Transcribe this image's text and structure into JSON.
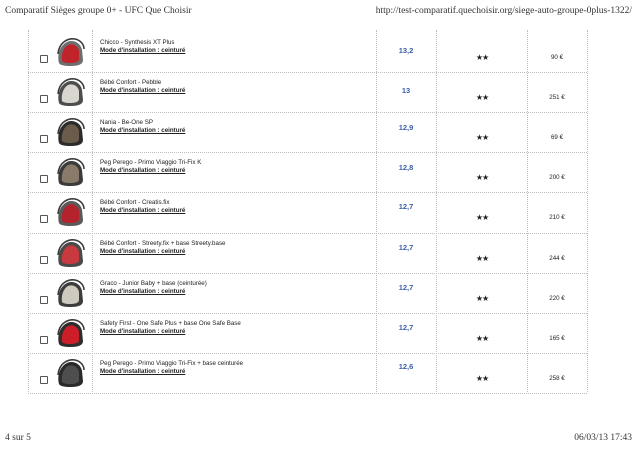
{
  "header": {
    "title": "Comparatif Sièges groupe 0+ - UFC Que Choisir",
    "url": "http://test-comparatif.quechoisir.org/siege-auto-groupe-0plus-1322/"
  },
  "footer": {
    "page": "4 sur 5",
    "datetime": "06/03/13 17:43"
  },
  "colors": {
    "score": "#3a5da8",
    "rule": "#bdbdbd"
  },
  "rows": [
    {
      "name": "Chicco  -  Synthesis XT Plus",
      "mode": "Mode d'installation : ceinturé",
      "score": "13,2",
      "stars": "★★",
      "price": "90 €",
      "seat_color": "#c0242a",
      "shell_color": "#6e6e6e"
    },
    {
      "name": "Bébé Confort  -  Pebble",
      "mode": "Mode d'installation : ceinturé",
      "score": "13",
      "stars": "★★",
      "price": "251 €",
      "seat_color": "#d9d6cf",
      "shell_color": "#4d4d4d"
    },
    {
      "name": "Nania  -  Be-One SP",
      "mode": "Mode d'installation : ceinturé",
      "score": "12,9",
      "stars": "★★",
      "price": "69 €",
      "seat_color": "#6b5b4a",
      "shell_color": "#2c2c2c"
    },
    {
      "name": "Peg Perego  -  Primo Viaggio Tri-Fix K",
      "mode": "Mode d'installation : ceinturé",
      "score": "12,8",
      "stars": "★★",
      "price": "200 €",
      "seat_color": "#8a7a6a",
      "shell_color": "#3b3b3b"
    },
    {
      "name": "Bébé Confort  -  Creatis.fix",
      "mode": "Mode d'installation : ceinturé",
      "score": "12,7",
      "stars": "★★",
      "price": "210 €",
      "seat_color": "#b4232b",
      "shell_color": "#5a5a5a"
    },
    {
      "name": "Bébé Confort  -  Streety.fix + base Streety.base",
      "mode": "Mode d'installation : ceinturé",
      "score": "12,7",
      "stars": "★★",
      "price": "244 €",
      "seat_color": "#c83a3f",
      "shell_color": "#4a4a4a"
    },
    {
      "name": "Graco  -  Junior Baby + base (ceinturée)",
      "mode": "Mode d'installation : ceinturé",
      "score": "12,7",
      "stars": "★★",
      "price": "220 €",
      "seat_color": "#cfcac0",
      "shell_color": "#3d3d3d"
    },
    {
      "name": "Safety First  -  One Safe Plus + base One Safe Base",
      "mode": "Mode d'installation : ceinturé",
      "score": "12,7",
      "stars": "★★",
      "price": "165 €",
      "seat_color": "#cc1e28",
      "shell_color": "#2e2e2e"
    },
    {
      "name": "Peg Perego  -  Primo Viaggio Tri-Fix + base ceinturée",
      "mode": "Mode d'installation : ceinturé",
      "score": "12,6",
      "stars": "★★",
      "price": "258 €",
      "seat_color": "#4e4e4e",
      "shell_color": "#2a2a2a"
    }
  ]
}
